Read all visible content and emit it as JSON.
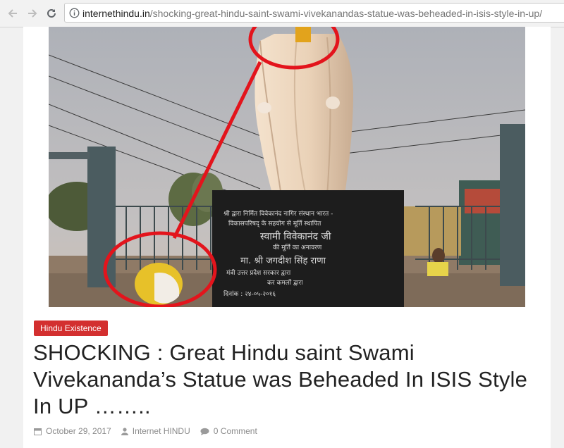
{
  "browser": {
    "url_host": "internethindu.in",
    "url_path": "/shocking-great-hindu-saint-swami-vivekanandas-statue-was-beheaded-in-isis-style-in-up/"
  },
  "photo": {
    "plaque_lines": [
      "श्री द्वारा निर्मित विवेकानंद नागिर संस्थान भारत -",
      "विकासपरिषद् के सहयोग से मूर्ति स्थापित",
      "स्वामी विवेकानंद जी",
      "की मूर्ति का अनावरण",
      "मा. श्री जगदीश सिंह राणा",
      "मंत्री उत्तर प्रदेश सरकार द्वारा",
      "कर कमलों द्वारा",
      "दिनांक : २४-०५-२०१६"
    ]
  },
  "post": {
    "category": "Hindu Existence",
    "title": "SHOCKING : Great Hindu saint Swami Vivekananda’s Statue was Beheaded In ISIS Style In UP ……..",
    "date": "October 29, 2017",
    "author": "Internet HINDU",
    "comments": "0 Comment"
  },
  "colors": {
    "badge_bg": "#d32f2f",
    "highlight_red": "#e3141c"
  },
  "icons": [
    "back-arrow-icon",
    "forward-arrow-icon",
    "reload-icon",
    "info-icon",
    "calendar-icon",
    "user-icon",
    "comment-icon"
  ]
}
